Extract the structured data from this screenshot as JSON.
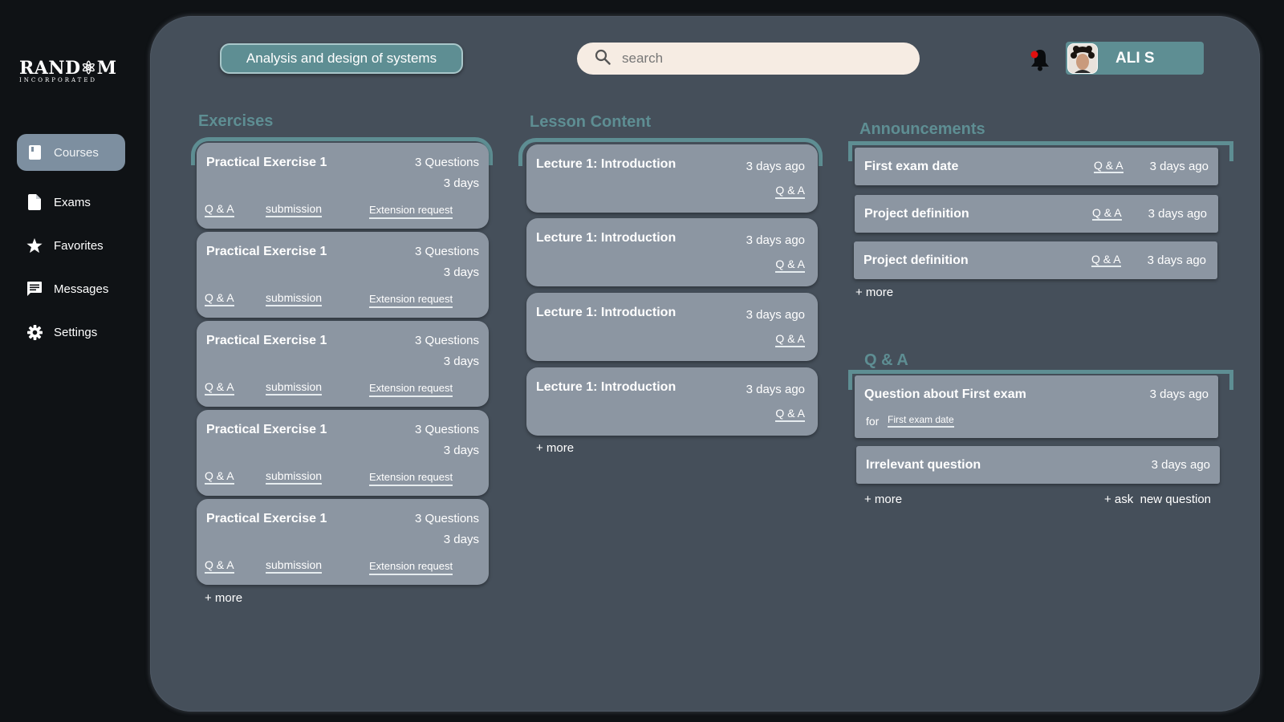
{
  "sidebar": {
    "logo": {
      "brand": "RAND⚛M",
      "sub": "INCORPORATED"
    },
    "items": [
      {
        "label": "Courses",
        "icon": "book-icon",
        "active": true
      },
      {
        "label": "Exams",
        "icon": "document-icon"
      },
      {
        "label": "Favorites",
        "icon": "star-icon"
      },
      {
        "label": "Messages",
        "icon": "chat-icon"
      },
      {
        "label": "Settings",
        "icon": "gear-icon"
      }
    ]
  },
  "header": {
    "course": "Analysis and design of systems",
    "search_placeholder": "search",
    "user_name": "ALI S",
    "notification_dot_color": "#e10f0f"
  },
  "exercises": {
    "title": "Exercises",
    "items": [
      {
        "title": "Practical Exercise 1",
        "questions": "3 Questions",
        "due": "3 days",
        "qa": "Q & A",
        "submission": "submission",
        "extension": "Extension request"
      },
      {
        "title": "Practical Exercise 1",
        "questions": "3 Questions",
        "due": "3 days",
        "qa": "Q & A",
        "submission": "submission",
        "extension": "Extension request"
      },
      {
        "title": "Practical Exercise 1",
        "questions": "3 Questions",
        "due": "3 days",
        "qa": "Q & A",
        "submission": "submission",
        "extension": "Extension request"
      },
      {
        "title": "Practical Exercise 1",
        "questions": "3 Questions",
        "due": "3 days",
        "qa": "Q & A",
        "submission": "submission",
        "extension": "Extension request"
      },
      {
        "title": "Practical Exercise 1",
        "questions": "3 Questions",
        "due": "3 days",
        "qa": "Q & A",
        "submission": "submission",
        "extension": "Extension request"
      }
    ],
    "more": "+ more"
  },
  "lessons": {
    "title": "Lesson Content",
    "items": [
      {
        "title": "Lecture 1: Introduction",
        "time": "3 days ago",
        "qa": "Q & A"
      },
      {
        "title": "Lecture 1: Introduction",
        "time": "3 days ago",
        "qa": "Q & A"
      },
      {
        "title": "Lecture 1: Introduction",
        "time": "3 days ago",
        "qa": "Q & A"
      },
      {
        "title": "Lecture 1: Introduction",
        "time": "3 days ago",
        "qa": "Q & A"
      }
    ],
    "more": "+ more"
  },
  "announcements": {
    "title": "Announcements",
    "items": [
      {
        "title": "First exam date",
        "qa": "Q & A",
        "time": "3 days ago"
      },
      {
        "title": "Project definition",
        "qa": "Q & A",
        "time": "3 days ago"
      },
      {
        "title": "Project definition",
        "qa": "Q & A",
        "time": "3 days ago"
      }
    ],
    "more": "+ more"
  },
  "qa": {
    "title": "Q & A",
    "items": [
      {
        "title": "Question about First exam",
        "time": "3 days ago",
        "for_label": "for",
        "for_link": "First exam date"
      },
      {
        "title": "Irrelevant question",
        "time": "3 days ago"
      }
    ],
    "more": "+ more",
    "ask_prefix": "+ ask",
    "ask_label": "new question"
  },
  "colors": {
    "accent": "#5e8e93",
    "panel": "#454f5a",
    "card": "#8c96a2",
    "background": "#0f1215"
  }
}
